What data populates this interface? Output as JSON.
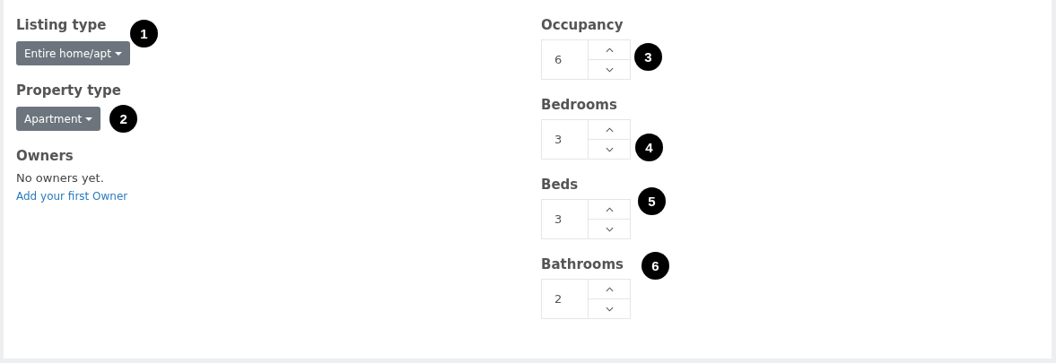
{
  "left_fields": [
    {
      "kind": "dropdown",
      "label": "Listing type",
      "value": "Entire home/apt",
      "callout": "1"
    },
    {
      "kind": "dropdown",
      "label": "Property type",
      "value": "Apartment",
      "callout": "2"
    },
    {
      "kind": "list",
      "label": "Owners",
      "empty_text": "No owners yet.",
      "link": "Add your first Owner"
    }
  ],
  "right_fields": [
    {
      "label": "Occupancy",
      "value": "6",
      "callout": "3"
    },
    {
      "label": "Bedrooms",
      "value": "3",
      "callout": "4"
    },
    {
      "label": "Beds",
      "value": "3",
      "callout": "5"
    },
    {
      "label": "Bathrooms",
      "value": "2",
      "callout": "6"
    }
  ]
}
